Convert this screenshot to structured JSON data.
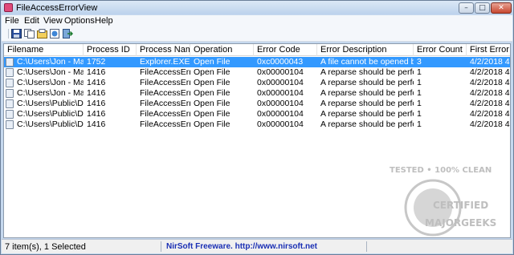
{
  "window": {
    "title": "FileAccessErrorView"
  },
  "window_controls": {
    "minimize": "–",
    "maximize": "□",
    "close": "✕"
  },
  "menu": [
    "File",
    "Edit",
    "View",
    "Options",
    "Help"
  ],
  "toolbar_icons": [
    "save-icon",
    "copy-icon",
    "properties-icon",
    "html-report-icon",
    "exit-icon"
  ],
  "columns": [
    "Filename",
    "Process ID",
    "Process Name",
    "Operation",
    "Error Code",
    "Error Description",
    "Error Count",
    "First Error Time"
  ],
  "rows": [
    [
      "C:\\Users\\Jon - Major...",
      "1752",
      "Explorer.EXE",
      "Open File",
      "0xc0000043",
      "A file cannot be opened beca...",
      "3",
      "4/2/2018 4:17:2"
    ],
    [
      "C:\\Users\\Jon - Major...",
      "1416",
      "FileAccessError...",
      "Open File",
      "0x00000104",
      "A reparse should be performe...",
      "1",
      "4/2/2018 4:17:3"
    ],
    [
      "C:\\Users\\Jon - Major...",
      "1416",
      "FileAccessError...",
      "Open File",
      "0x00000104",
      "A reparse should be performe...",
      "1",
      "4/2/2018 4:17:3"
    ],
    [
      "C:\\Users\\Jon - Major...",
      "1416",
      "FileAccessError...",
      "Open File",
      "0x00000104",
      "A reparse should be performe...",
      "1",
      "4/2/2018 4:17:3"
    ],
    [
      "C:\\Users\\Public\\Doc...",
      "1416",
      "FileAccessError...",
      "Open File",
      "0x00000104",
      "A reparse should be performe...",
      "1",
      "4/2/2018 4:17:3"
    ],
    [
      "C:\\Users\\Public\\Doc...",
      "1416",
      "FileAccessError...",
      "Open File",
      "0x00000104",
      "A reparse should be performe...",
      "1",
      "4/2/2018 4:17:3"
    ],
    [
      "C:\\Users\\Public\\Doc...",
      "1416",
      "FileAccessError...",
      "Open File",
      "0x00000104",
      "A reparse should be performe...",
      "1",
      "4/2/2018 4:17:3"
    ]
  ],
  "selected_row": 0,
  "status": {
    "items": "7 item(s), 1 Selected",
    "credit": "NirSoft Freeware.  http://www.nirsoft.net"
  },
  "watermark": {
    "line1": "TESTED • 100% CLEAN",
    "line2": "CERTIFIED",
    "line3": "MAJORGEEKS"
  },
  "colors": {
    "selection": "#3399ff",
    "title_bar": "#c5d8ee",
    "credit_link": "#1a2fb4"
  }
}
